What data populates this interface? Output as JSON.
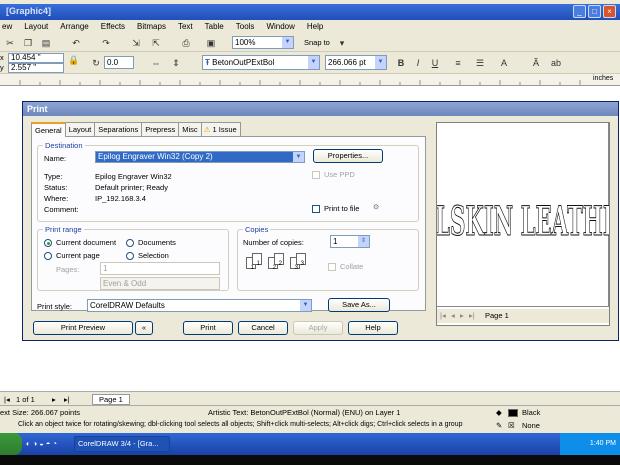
{
  "app": {
    "title": "[Graphic4]"
  },
  "menu": [
    "ew",
    "Layout",
    "Arrange",
    "Effects",
    "Bitmaps",
    "Text",
    "Table",
    "Tools",
    "Window",
    "Help"
  ],
  "toolbar": {
    "zoom_value": "100%",
    "snap_to_label": "Snap to"
  },
  "propbar": {
    "x_value": "10.454 \"",
    "y_value": "2.557 \"",
    "angle_value": "0.0",
    "font_name": "BetonOutPExtBol",
    "font_size": "266.066 pt",
    "ruler_unit": "inches"
  },
  "dialog": {
    "title": "Print",
    "tabs": [
      "General",
      "Layout",
      "Separations",
      "Prepress",
      "Misc",
      "1 Issue"
    ],
    "destination": {
      "legend": "Destination",
      "name_label": "Name:",
      "name_value": "Epilog Engraver Win32 (Copy 2)",
      "properties_button": "Properties...",
      "type_label": "Type:",
      "type_value": "Epilog Engraver Win32",
      "status_label": "Status:",
      "status_value": "Default printer; Ready",
      "where_label": "Where:",
      "where_value": "IP_192.168.3.4",
      "comment_label": "Comment:",
      "use_ppd_label": "Use PPD",
      "print_to_file_label": "Print to file"
    },
    "print_range": {
      "legend": "Print range",
      "current_document": "Current document",
      "documents": "Documents",
      "current_page": "Current page",
      "selection": "Selection",
      "pages_label": "Pages:",
      "pages_value": "1",
      "even_odd_value": "Even & Odd"
    },
    "copies": {
      "legend": "Copies",
      "number_label": "Number of copies:",
      "number_value": "1",
      "collate_label": "Collate"
    },
    "print_style_label": "Print style:",
    "print_style_value": "CorelDRAW Defaults",
    "save_as_button": "Save As...",
    "buttons": {
      "print_preview": "Print Preview",
      "print": "Print",
      "cancel": "Cancel",
      "apply": "Apply",
      "help": "Help"
    },
    "preview": {
      "text": "ELSKIN LEATHE",
      "page_label": "Page 1"
    }
  },
  "pagebar": {
    "page_count": "1 of 1",
    "page_tab": "Page 1"
  },
  "status": {
    "text_size": "ext Size: 266.067 points",
    "object_info": "Artistic Text: BetonOutPExtBol (Normal) (ENU) on Layer 1",
    "hint": "Click an object twice for rotating/skewing; dbl-clicking tool selects all objects; Shift+click multi-selects; Alt+click digs; Ctrl+click selects in a group",
    "fill_label": "Black",
    "outline_label": "None"
  },
  "taskbar": {
    "task_label": "CorelDRAW 3/4 - [Gra...",
    "clock": "1:40 PM"
  },
  "colors": {
    "title_bar": "#1f4fb8",
    "selection": "#316ac5",
    "dialog_bg": "#ece9d8"
  }
}
